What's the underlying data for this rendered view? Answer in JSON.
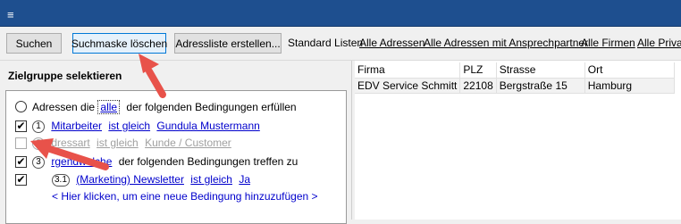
{
  "toolbar": {
    "search_label": "Suchen",
    "clear_label": "Suchmaske löschen",
    "create_list_label": "Adressliste erstellen...",
    "standard_lists_label": "Standard Listen",
    "links": [
      "Alle Adressen",
      "Alle Adressen mit Ansprechpartner",
      "Alle Firmen",
      "Alle Privat"
    ]
  },
  "left": {
    "title": "Zielgruppe selektieren",
    "root": {
      "prefix": "Adressen die",
      "quantifier": "alle",
      "suffix": "der folgenden Bedingungen erfüllen"
    },
    "conditions": [
      {
        "num": "1",
        "field": "Mitarbeiter",
        "op": "ist gleich",
        "value": "Gundula Mustermann",
        "checked": true
      },
      {
        "num": "2",
        "field": "Adressart",
        "field_visible": "dressart",
        "op": "ist gleich",
        "value": "Kunde / Customer",
        "checked": false
      },
      {
        "num": "3",
        "quantifier": "irgendwelche",
        "quantifier_visible": "rgendwelche",
        "suffix": "der folgenden Bedingungen treffen zu",
        "checked": true
      },
      {
        "num": "3.1",
        "field": "(Marketing) Newsletter",
        "op": "ist gleich",
        "value": "Ja",
        "checked": true
      }
    ],
    "add_hint": "< Hier klicken, um eine neue Bedingung hinzuzufügen >"
  },
  "grid": {
    "headers": [
      "Firma",
      "PLZ",
      "Strasse",
      "Ort"
    ],
    "rows": [
      [
        "EDV Service Schmitt",
        "22108",
        "Bergstraße 15",
        "Hamburg"
      ]
    ]
  },
  "colors": {
    "title_bar": "#1e4f8f",
    "arrow": "#e8524a",
    "link": "#0000cc"
  }
}
